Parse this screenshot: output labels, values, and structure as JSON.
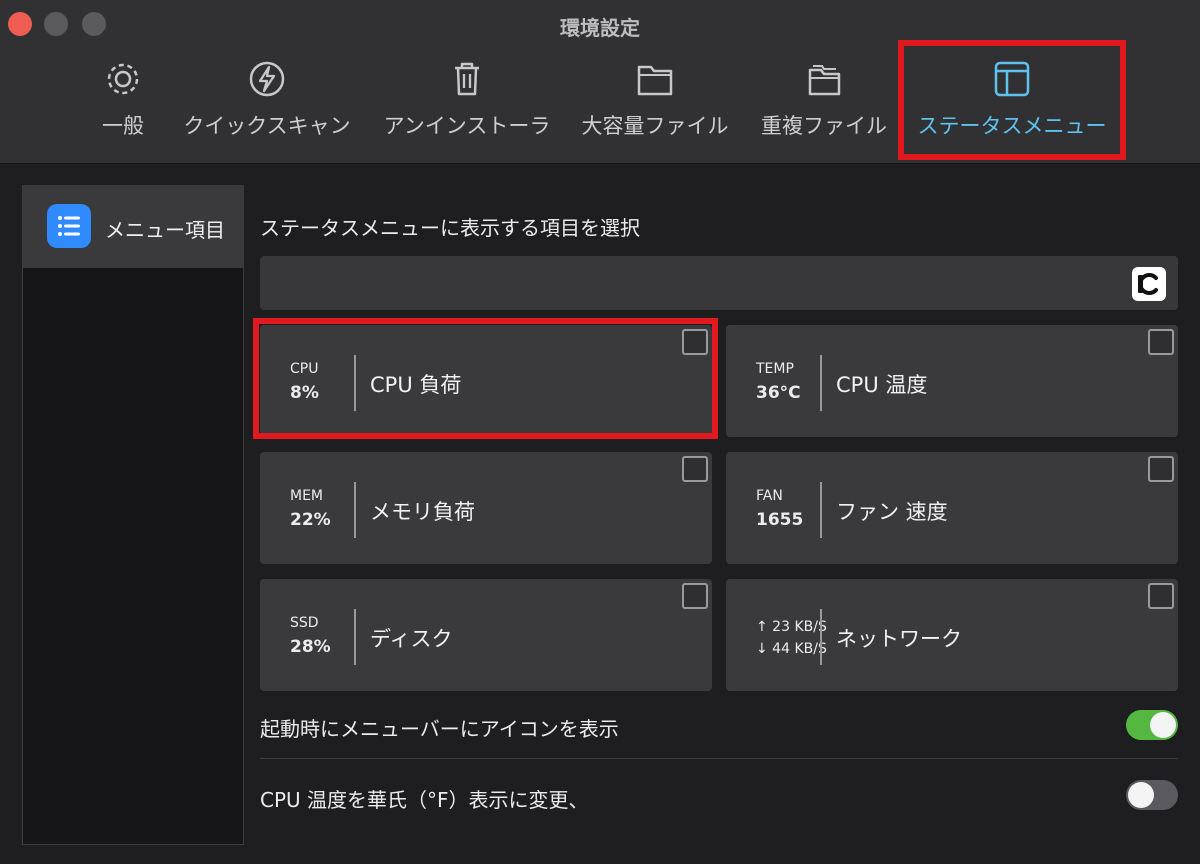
{
  "window": {
    "title": "環境設定"
  },
  "toolbar": {
    "tabs": [
      {
        "label": "一般",
        "icon": "gear-icon"
      },
      {
        "label": "クイックスキャン",
        "icon": "lightning-icon"
      },
      {
        "label": "アンインストーラ",
        "icon": "trash-icon"
      },
      {
        "label": "大容量ファイル",
        "icon": "folder-icon"
      },
      {
        "label": "重複ファイル",
        "icon": "folders-icon"
      },
      {
        "label": "ステータスメニュー",
        "icon": "window-layout-icon",
        "active": true
      }
    ],
    "active_color": "#5fc3f0"
  },
  "sidebar": {
    "items": [
      {
        "label": "メニュー項目",
        "icon": "list-icon",
        "selected": true
      }
    ]
  },
  "main": {
    "section_title": "ステータスメニューに表示する項目を選択",
    "cards": [
      {
        "badge_name": "CPU",
        "badge_value": "8%",
        "title": "CPU 負荷",
        "checked": false
      },
      {
        "badge_name": "TEMP",
        "badge_value": "36°C",
        "title": "CPU 温度",
        "checked": false
      },
      {
        "badge_name": "MEM",
        "badge_value": "22%",
        "title": "メモリ負荷",
        "checked": false
      },
      {
        "badge_name": "FAN",
        "badge_value": "1655",
        "title": "ファン 速度",
        "checked": false
      },
      {
        "badge_name": "SSD",
        "badge_value": "28%",
        "title": "ディスク",
        "checked": false
      },
      {
        "badge_up": "↑ 23 KB/S",
        "badge_down": "↓ 44 KB/S",
        "title": "ネットワーク",
        "checked": false
      }
    ],
    "options": [
      {
        "label": "起動時にメニューバーにアイコンを表示",
        "enabled": true
      },
      {
        "label": "CPU 温度を華氏（°F）表示に変更、",
        "enabled": false
      }
    ]
  },
  "colors": {
    "highlight": "#e11a1f",
    "toggle_on": "#54b840",
    "accent": "#2f8bff"
  }
}
